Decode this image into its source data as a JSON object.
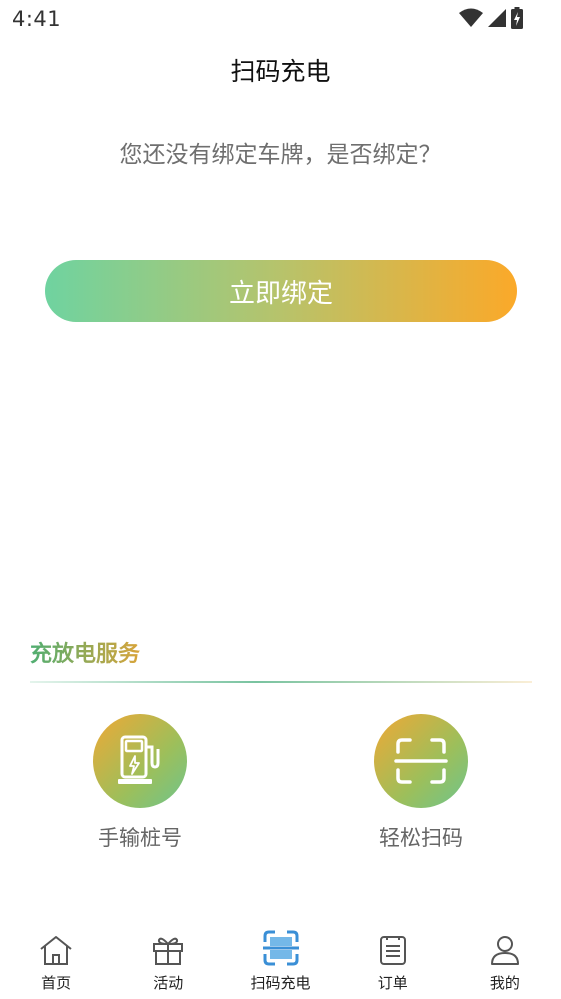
{
  "status": {
    "time": "4:41"
  },
  "header": {
    "title": "扫码充电"
  },
  "main": {
    "prompt": "您还没有绑定车牌，是否绑定？",
    "bind_button": "立即绑定"
  },
  "services": {
    "title": "充放电服务",
    "items": [
      {
        "label": "手输桩号",
        "icon": "charging-pile-icon"
      },
      {
        "label": "轻松扫码",
        "icon": "scan-frame-icon"
      }
    ]
  },
  "tabbar": {
    "items": [
      {
        "label": "首页",
        "icon": "home-icon"
      },
      {
        "label": "活动",
        "icon": "gift-icon"
      },
      {
        "label": "扫码充电",
        "icon": "scan-icon",
        "active": true
      },
      {
        "label": "订单",
        "icon": "order-icon"
      },
      {
        "label": "我的",
        "icon": "user-icon"
      }
    ]
  },
  "colors": {
    "accent_start": "#6fd3a0",
    "accent_end": "#fba929",
    "active_tab": "#3a8fd6"
  }
}
